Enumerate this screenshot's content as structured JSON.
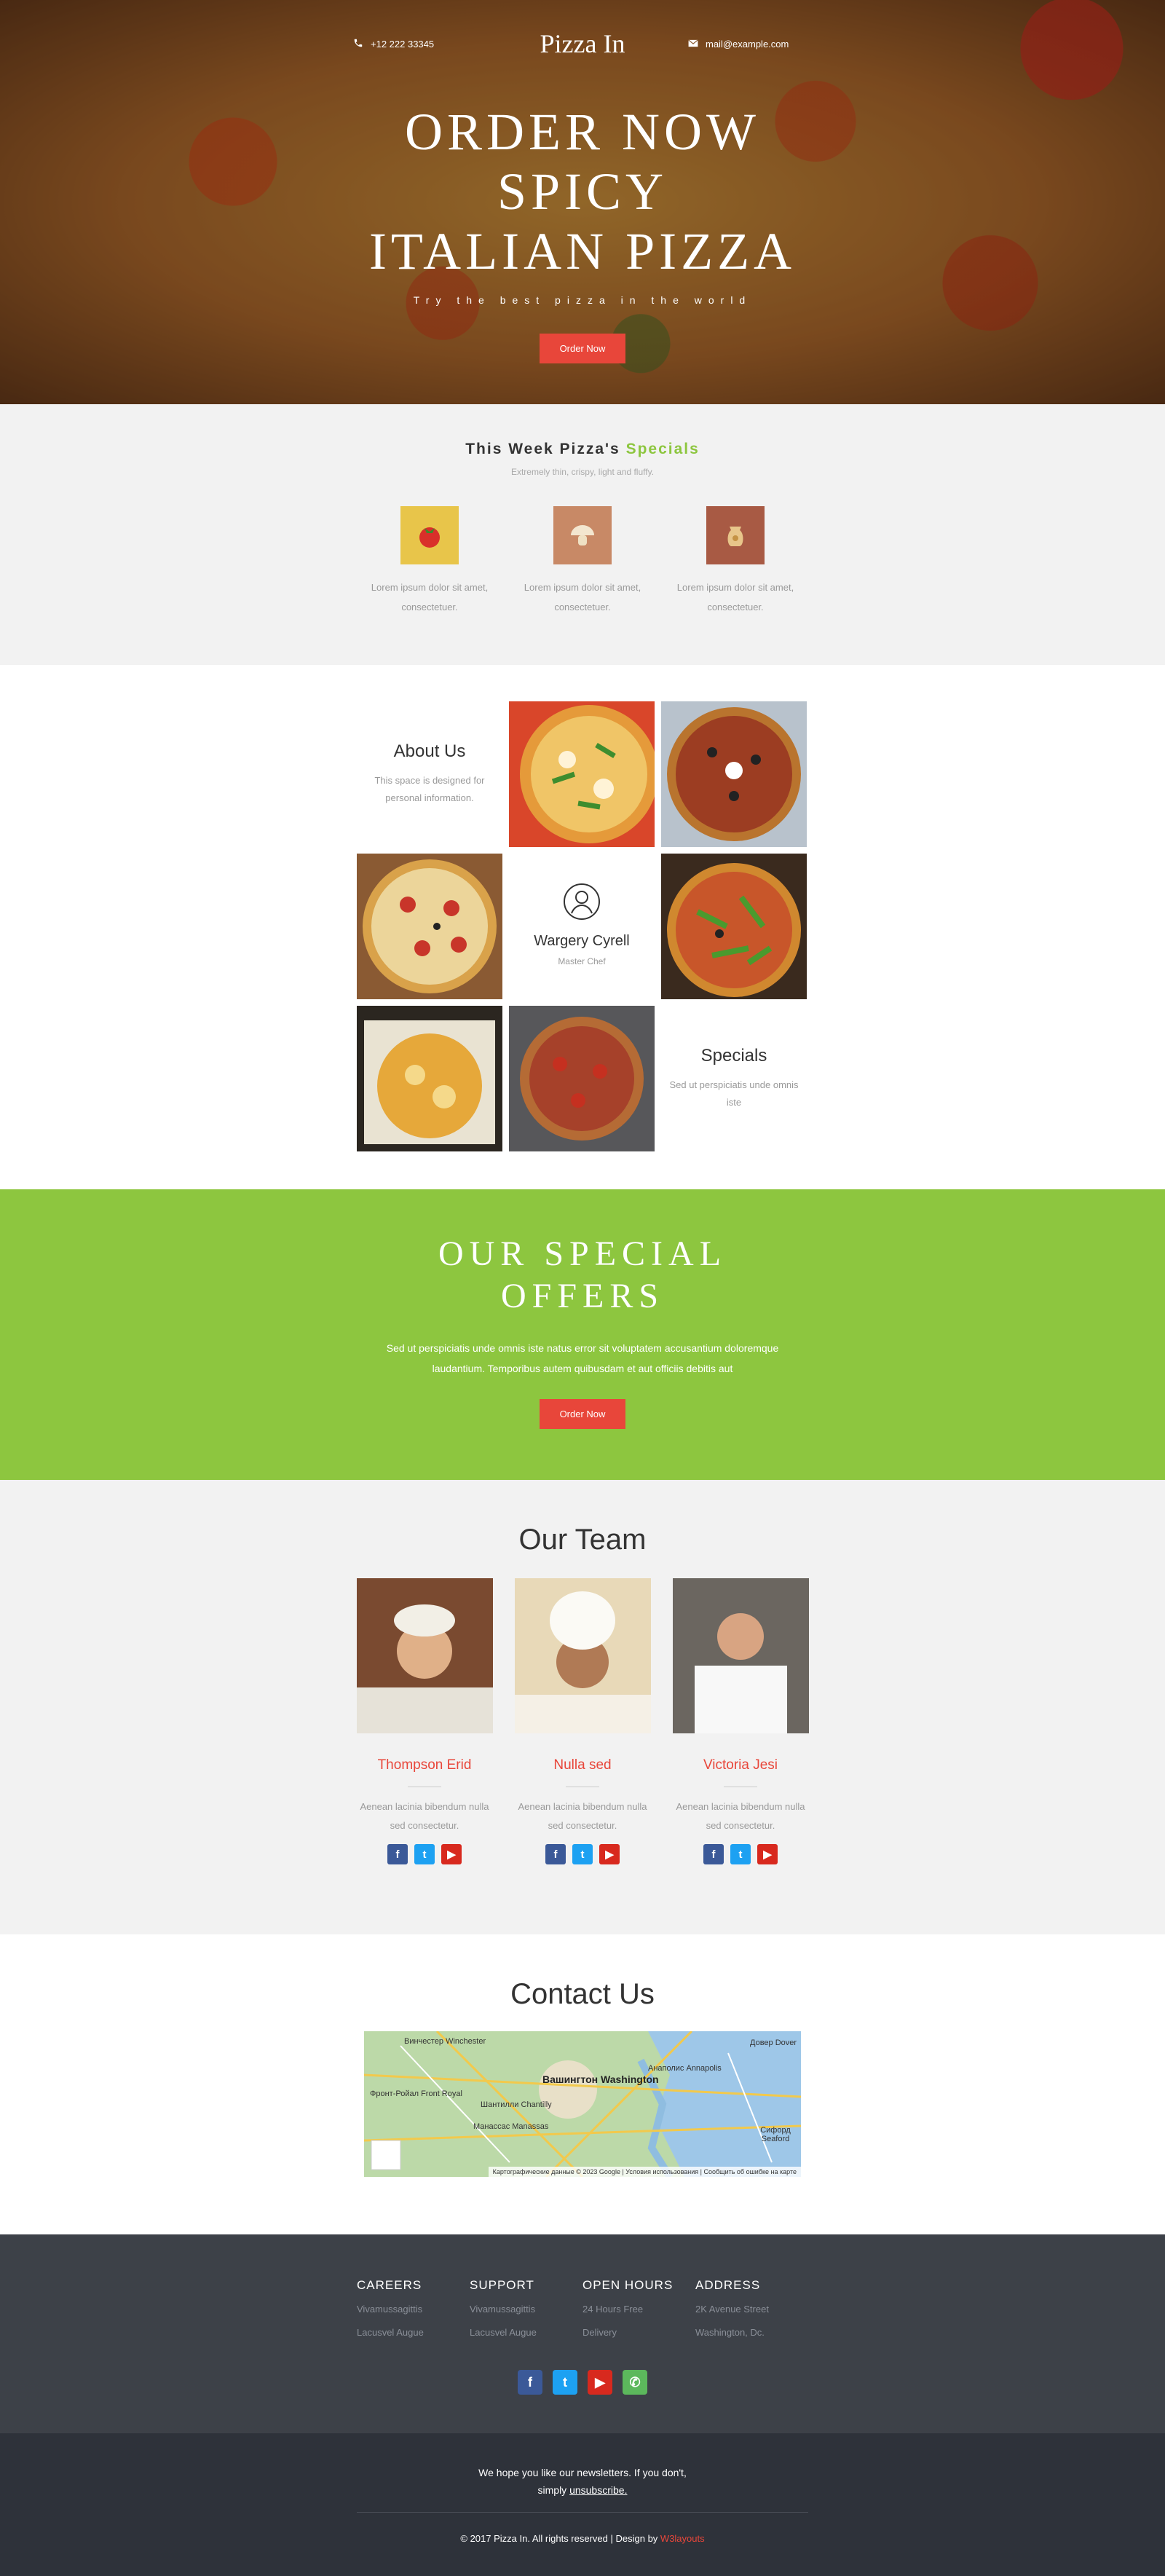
{
  "colors": {
    "accent_red": "#e8463a",
    "accent_green": "#8dc63f",
    "footer_dark": "#3d4148",
    "footer_darker": "#2e323a"
  },
  "header": {
    "phone": "+12 222 33345",
    "logo": "Pizza In",
    "email": "mail@example.com"
  },
  "hero": {
    "title_line1": "ORDER NOW",
    "title_line2": "SPICY",
    "title_line3": "ITALIAN PIZZA",
    "tagline": "Try the best pizza in the world",
    "button": "Order Now"
  },
  "specials": {
    "title_prefix": "This Week Pizza's",
    "title_highlight": "Specials",
    "subtitle": "Extremely thin, crispy, light and fluffy.",
    "items": [
      {
        "icon": "tomato-icon",
        "text": "Lorem ipsum dolor sit amet, consectetuer."
      },
      {
        "icon": "mushroom-icon",
        "text": "Lorem ipsum dolor sit amet, consectetuer."
      },
      {
        "icon": "flour-sack-icon",
        "text": "Lorem ipsum dolor sit amet, consectetuer."
      }
    ]
  },
  "gallery": {
    "about_title": "About Us",
    "about_text": "This space is designed for personal information.",
    "chef_name": "Wargery Cyrell",
    "chef_role": "Master Chef",
    "specials_title": "Specials",
    "specials_text": "Sed ut perspiciatis unde omnis iste"
  },
  "offers": {
    "title_line1": "OUR SPECIAL",
    "title_line2": "OFFERS",
    "text": "Sed ut perspiciatis unde omnis iste natus error sit voluptatem accusantium doloremque laudantium. Temporibus autem quibusdam et aut officiis debitis aut",
    "button": "Order Now"
  },
  "team": {
    "title": "Our Team",
    "members": [
      {
        "name": "Thompson Erid",
        "text": "Aenean lacinia bibendum nulla sed consectetur."
      },
      {
        "name": "Nulla sed",
        "text": "Aenean lacinia bibendum nulla sed consectetur."
      },
      {
        "name": "Victoria Jesi",
        "text": "Aenean lacinia bibendum nulla sed consectetur."
      }
    ]
  },
  "contact": {
    "title": "Contact Us",
    "map_city": "Вашингтон Washington",
    "map_labels": [
      "Винчестер Winchester",
      "Фронт-Ройал Front Royal",
      "Шантилли Chantilly",
      "Манассас Manassas",
      "Анаполис Annapolis",
      "Довер Dover",
      "Сифорд Seaford"
    ],
    "map_credit": "Картографические данные © 2023 Google | Условия использования | Сообщить об ошибке на карте"
  },
  "footer": {
    "columns": [
      {
        "title": "CAREERS",
        "line1": "Vivamussagittis",
        "line2": "Lacusvel Augue"
      },
      {
        "title": "SUPPORT",
        "line1": "Vivamussagittis",
        "line2": "Lacusvel Augue"
      },
      {
        "title": "OPEN HOURS",
        "line1": "24 Hours Free",
        "line2": "Delivery"
      },
      {
        "title": "ADDRESS",
        "line1": "2K Avenue Street",
        "line2": "Washington, Dc."
      }
    ],
    "newsletter_line1": "We hope you like our newsletters. If you don't,",
    "newsletter_prefix": "simply",
    "unsubscribe": "unsubscribe.",
    "copyright": "© 2017 Pizza In. All rights reserved | Design by",
    "designer": "W3layouts"
  }
}
